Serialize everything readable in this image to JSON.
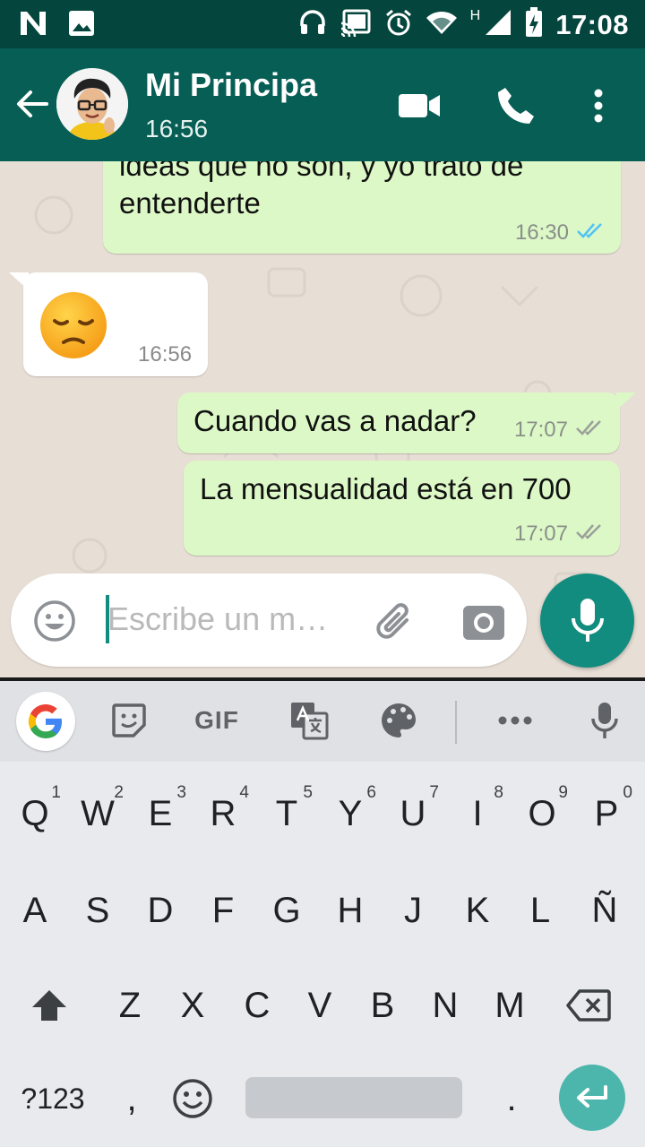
{
  "status_bar": {
    "time": "17:08",
    "network_label": "H",
    "icons": [
      "n-logo-icon",
      "image-icon",
      "headphones-icon",
      "cast-icon",
      "alarm-icon",
      "wifi-icon",
      "signal-icon",
      "battery-charging-icon"
    ]
  },
  "header": {
    "contact_name": "Mi Principa",
    "last_seen": "16:56",
    "icons": [
      "back-arrow-icon",
      "video-call-icon",
      "phone-icon",
      "more-vert-icon"
    ]
  },
  "messages": [
    {
      "direction": "outgoing",
      "lines": [
        "ideas que no son, y yo trato de",
        "entenderte"
      ],
      "time": "16:30",
      "status": "read"
    },
    {
      "direction": "incoming",
      "emoji": "😞",
      "time": "16:56"
    },
    {
      "direction": "outgoing",
      "lines": [
        "Cuando vas a nadar?"
      ],
      "time": "17:07",
      "status": "delivered"
    },
    {
      "direction": "outgoing",
      "lines": [
        "La mensualidad está en 700"
      ],
      "time": "17:07",
      "status": "delivered"
    }
  ],
  "composer": {
    "placeholder": "Escribe un m…",
    "icons": [
      "emoji-icon",
      "attach-icon",
      "camera-icon",
      "mic-icon"
    ]
  },
  "keyboard": {
    "toolbar": {
      "gif_label": "GIF",
      "icons": [
        "google-icon",
        "sticker-icon",
        "translate-icon",
        "palette-icon",
        "more-horiz-icon",
        "mic-icon"
      ]
    },
    "row1": [
      "Q",
      "W",
      "E",
      "R",
      "T",
      "Y",
      "U",
      "I",
      "O",
      "P"
    ],
    "row1_hints": [
      "1",
      "2",
      "3",
      "4",
      "5",
      "6",
      "7",
      "8",
      "9",
      "0"
    ],
    "row2": [
      "A",
      "S",
      "D",
      "F",
      "G",
      "H",
      "J",
      "K",
      "L",
      "Ñ"
    ],
    "row3": [
      "Z",
      "X",
      "C",
      "V",
      "B",
      "N",
      "M"
    ],
    "symbols_key": "?123",
    "comma_key": ",",
    "period_key": "."
  },
  "colors": {
    "header": "#075e54",
    "status_bar": "#04463d",
    "outgoing_bubble": "#dcf8c6",
    "incoming_bubble": "#ffffff",
    "accent": "#128c7e",
    "read_ticks": "#4fc3f7"
  }
}
